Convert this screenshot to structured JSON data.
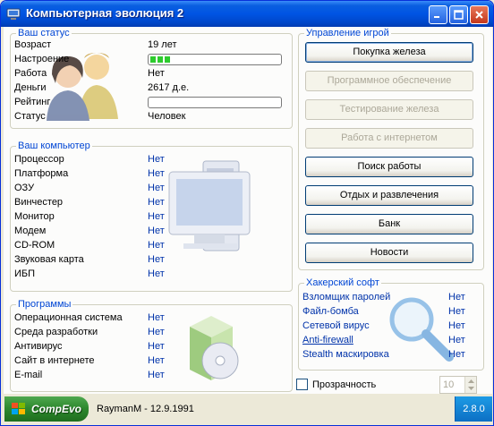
{
  "window": {
    "title": "Компьютерная эволюция 2"
  },
  "status": {
    "title": "Ваш статус",
    "rows": [
      {
        "label": "Возраст",
        "value": "19 лет"
      },
      {
        "label": "Настроение",
        "value": ""
      },
      {
        "label": "Работа",
        "value": "Нет"
      },
      {
        "label": "Деньги",
        "value": "2617 д.е."
      },
      {
        "label": "Рейтинг",
        "value": ""
      },
      {
        "label": "Статус",
        "value": "Человек"
      }
    ],
    "mood_level": 0.17,
    "rating_level": 0.0
  },
  "computer": {
    "title": "Ваш компьютер",
    "rows": [
      {
        "label": "Процессор",
        "value": "Нет"
      },
      {
        "label": "Платформа",
        "value": "Нет"
      },
      {
        "label": "ОЗУ",
        "value": "Нет"
      },
      {
        "label": "Винчестер",
        "value": "Нет"
      },
      {
        "label": "Монитор",
        "value": "Нет"
      },
      {
        "label": "Модем",
        "value": "Нет"
      },
      {
        "label": "CD-ROM",
        "value": "Нет"
      },
      {
        "label": "Звуковая карта",
        "value": "Нет"
      },
      {
        "label": "ИБП",
        "value": "Нет"
      }
    ]
  },
  "programs": {
    "title": "Программы",
    "rows": [
      {
        "label": "Операционная система",
        "value": "Нет"
      },
      {
        "label": "Среда разработки",
        "value": "Нет"
      },
      {
        "label": "Антивирус",
        "value": "Нет"
      },
      {
        "label": "Сайт в интернете",
        "value": "Нет"
      },
      {
        "label": "E-mail",
        "value": "Нет"
      }
    ]
  },
  "control": {
    "title": "Управление игрой",
    "buttons": [
      {
        "label": "Покупка железа",
        "enabled": true
      },
      {
        "label": "Программное обеспечение",
        "enabled": false
      },
      {
        "label": "Тестирование железа",
        "enabled": false
      },
      {
        "label": "Работа с интернетом",
        "enabled": false
      },
      {
        "label": "Поиск работы",
        "enabled": true
      },
      {
        "label": "Отдых и развлечения",
        "enabled": true
      },
      {
        "label": "Банк",
        "enabled": true
      },
      {
        "label": "Новости",
        "enabled": true
      }
    ]
  },
  "hacker": {
    "title": "Хакерский софт",
    "rows": [
      {
        "label": "Взломщик паролей",
        "value": "Нет"
      },
      {
        "label": "Файл-бомба",
        "value": "Нет"
      },
      {
        "label": "Сетевой вирус",
        "value": "Нет"
      },
      {
        "label": "Anti-firewall",
        "value": "Нет"
      },
      {
        "label": "Stealth маскировка",
        "value": "Нет"
      }
    ]
  },
  "transparency": {
    "label": "Прозрачность",
    "checked": false,
    "value": "10"
  },
  "taskbar": {
    "start_label": "CompEvo 2",
    "player_info": "RaymanM - 12.9.1991",
    "version": "2.8.0"
  }
}
